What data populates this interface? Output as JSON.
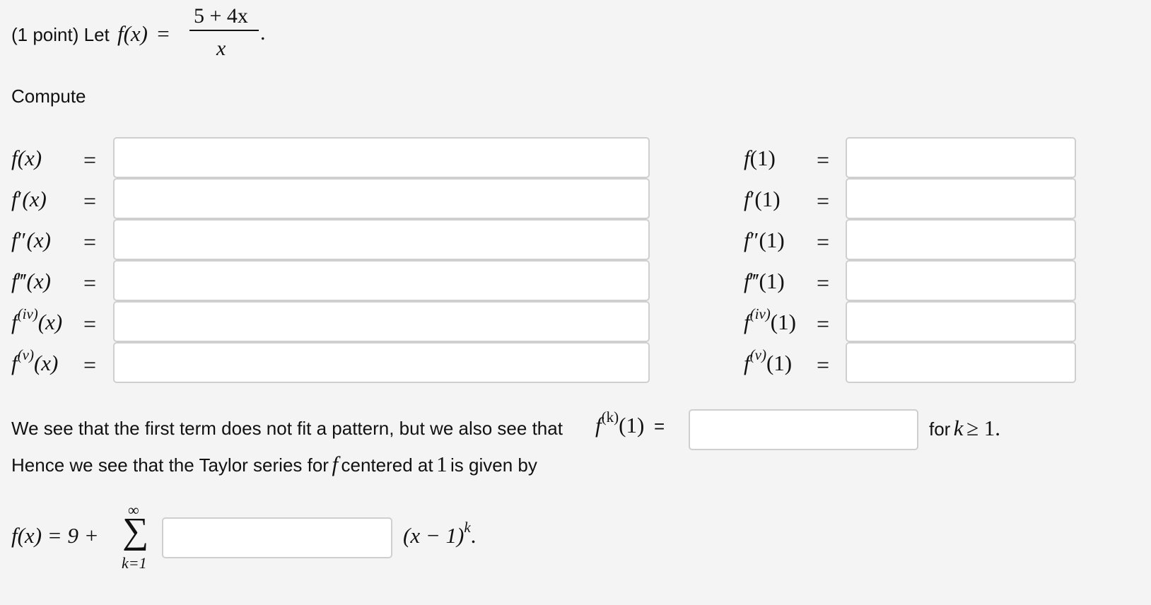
{
  "problem": {
    "intro": "(1 point) Let",
    "f_of_x": "f(x)",
    "equals": "=",
    "numerator": "5 + 4x",
    "denominator": "x",
    "period": "."
  },
  "compute_label": "Compute",
  "left_column": [
    {
      "fn": "f",
      "sup": "",
      "prime": "",
      "arg": "(x)",
      "eq": "="
    },
    {
      "fn": "f",
      "sup": "",
      "prime": "′",
      "arg": "(x)",
      "eq": "="
    },
    {
      "fn": "f",
      "sup": "",
      "prime": "″",
      "arg": "(x)",
      "eq": "="
    },
    {
      "fn": "f",
      "sup": "",
      "prime": "‴",
      "arg": "(x)",
      "eq": "="
    },
    {
      "fn": "f",
      "sup": "(iv)",
      "prime": "",
      "arg": "(x)",
      "eq": "="
    },
    {
      "fn": "f",
      "sup": "(v)",
      "prime": "",
      "arg": "(x)",
      "eq": "="
    }
  ],
  "right_column": [
    {
      "fn": "f",
      "sup": "",
      "prime": "",
      "arg": "(1)",
      "eq": "="
    },
    {
      "fn": "f",
      "sup": "",
      "prime": "′",
      "arg": "(1)",
      "eq": "="
    },
    {
      "fn": "f",
      "sup": "",
      "prime": "″",
      "arg": "(1)",
      "eq": "="
    },
    {
      "fn": "f",
      "sup": "",
      "prime": "‴",
      "arg": "(1)",
      "eq": "="
    },
    {
      "fn": "f",
      "sup": "(iv)",
      "prime": "",
      "arg": "(1)",
      "eq": "="
    },
    {
      "fn": "f",
      "sup": "(v)",
      "prime": "",
      "arg": "(1)",
      "eq": "="
    }
  ],
  "pattern": {
    "text": "We see that the first term does not fit a pattern, but we also see that",
    "fn": "f",
    "sup": "(k)",
    "arg": "(1)",
    "eq": "=",
    "for_text": "for",
    "k": "k",
    "ge": "≥ 1."
  },
  "hence": {
    "text_before": "Hence we see that the Taylor series for",
    "f": "f",
    "text_mid": "centered at",
    "one": "1",
    "text_after": "is given by"
  },
  "series": {
    "lhs": "f(x) = 9 +",
    "sigma": "∑",
    "upper": "∞",
    "lower": "k=1",
    "tail_base": "(x − 1)",
    "tail_exp": "k",
    "tail_period": "."
  }
}
